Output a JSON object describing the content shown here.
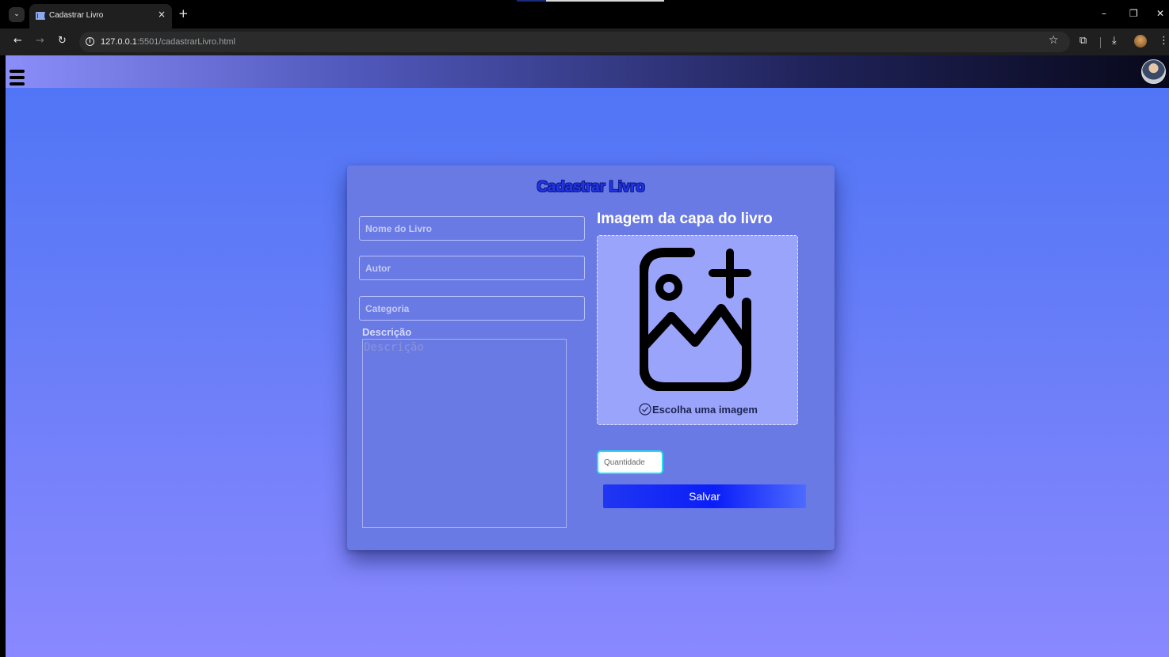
{
  "browser": {
    "tab_title": "Cadastrar Livro",
    "tab_close": "×",
    "new_tab": "+",
    "url_host": "127.0.0.1",
    "url_rest": ":5501/cadastrarLivro.html",
    "icons": [
      "tab-search-icon",
      "back-icon",
      "forward-icon",
      "reload-icon",
      "info-icon",
      "star-icon",
      "extensions-icon",
      "download-icon",
      "profile-icon",
      "menu-icon",
      "minimize-icon",
      "restore-icon",
      "close-icon"
    ]
  },
  "page": {
    "header": {
      "menu_icon": "hamburger-icon",
      "avatar_icon": "user-avatar"
    },
    "form": {
      "title": "Cadastrar Livro",
      "book_name_placeholder": "Nome do Livro",
      "author_placeholder": "Autor",
      "category_placeholder": "Categoria",
      "description_label": "Descrição",
      "description_placeholder": "Descrição",
      "image_label": "Imagem da capa do livro",
      "choose_image_text": "Escolha uma imagem",
      "quantity_placeholder": "Quantidade",
      "save_label": "Salvar"
    }
  },
  "colors": {
    "background_top": "#4d74f6",
    "background_bottom": "#8a88fe",
    "card": "#6a7ae4",
    "title": "#2236e8",
    "dropzone": "#9aa4fb",
    "button": "#0b1ef8"
  }
}
